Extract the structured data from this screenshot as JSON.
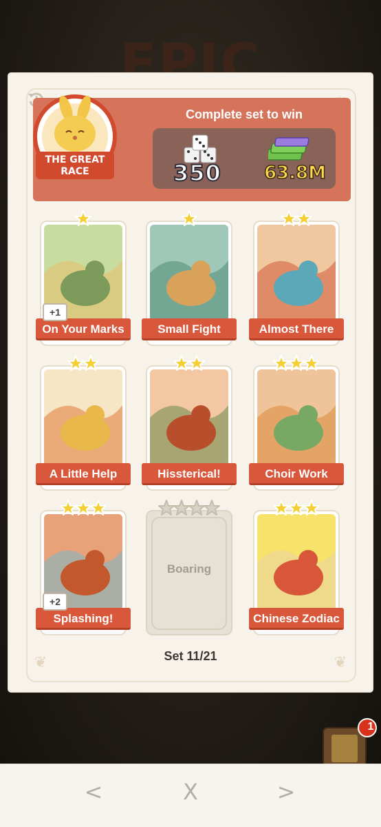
{
  "header_title": "EPIC",
  "set": {
    "name_line1": "THE GREAT",
    "name_line2": "RACE",
    "complete_text": "Complete set to win",
    "reward_dice": "350",
    "reward_cash": "63.8M",
    "progress": "Set 11/21"
  },
  "cards": [
    {
      "label": "On Your Marks",
      "stars": 1,
      "dupe": "+1",
      "owned": true
    },
    {
      "label": "Small Fight",
      "stars": 1,
      "dupe": "",
      "owned": true
    },
    {
      "label": "Almost There",
      "stars": 2,
      "dupe": "",
      "owned": true
    },
    {
      "label": "A Little Help",
      "stars": 2,
      "dupe": "",
      "owned": true
    },
    {
      "label": "Hissterical!",
      "stars": 2,
      "dupe": "",
      "owned": true
    },
    {
      "label": "Choir Work",
      "stars": 3,
      "dupe": "",
      "owned": true
    },
    {
      "label": "Splashing!",
      "stars": 3,
      "dupe": "+2",
      "owned": true
    },
    {
      "label": "Boaring",
      "stars": 4,
      "dupe": "",
      "owned": false
    },
    {
      "label": "Chinese Zodiac",
      "stars": 3,
      "dupe": "",
      "owned": true
    }
  ],
  "gift_badge": "1",
  "nav": {
    "back": "<",
    "close": "X",
    "forward": ">"
  },
  "colors": {
    "header_bg": "#d5745a",
    "label_bg": "#d9573a",
    "star": "#f4cf35"
  },
  "icons": [
    "history-icon",
    "dice-icon",
    "cash-stack-icon",
    "star-icon",
    "gift-box-icon"
  ]
}
